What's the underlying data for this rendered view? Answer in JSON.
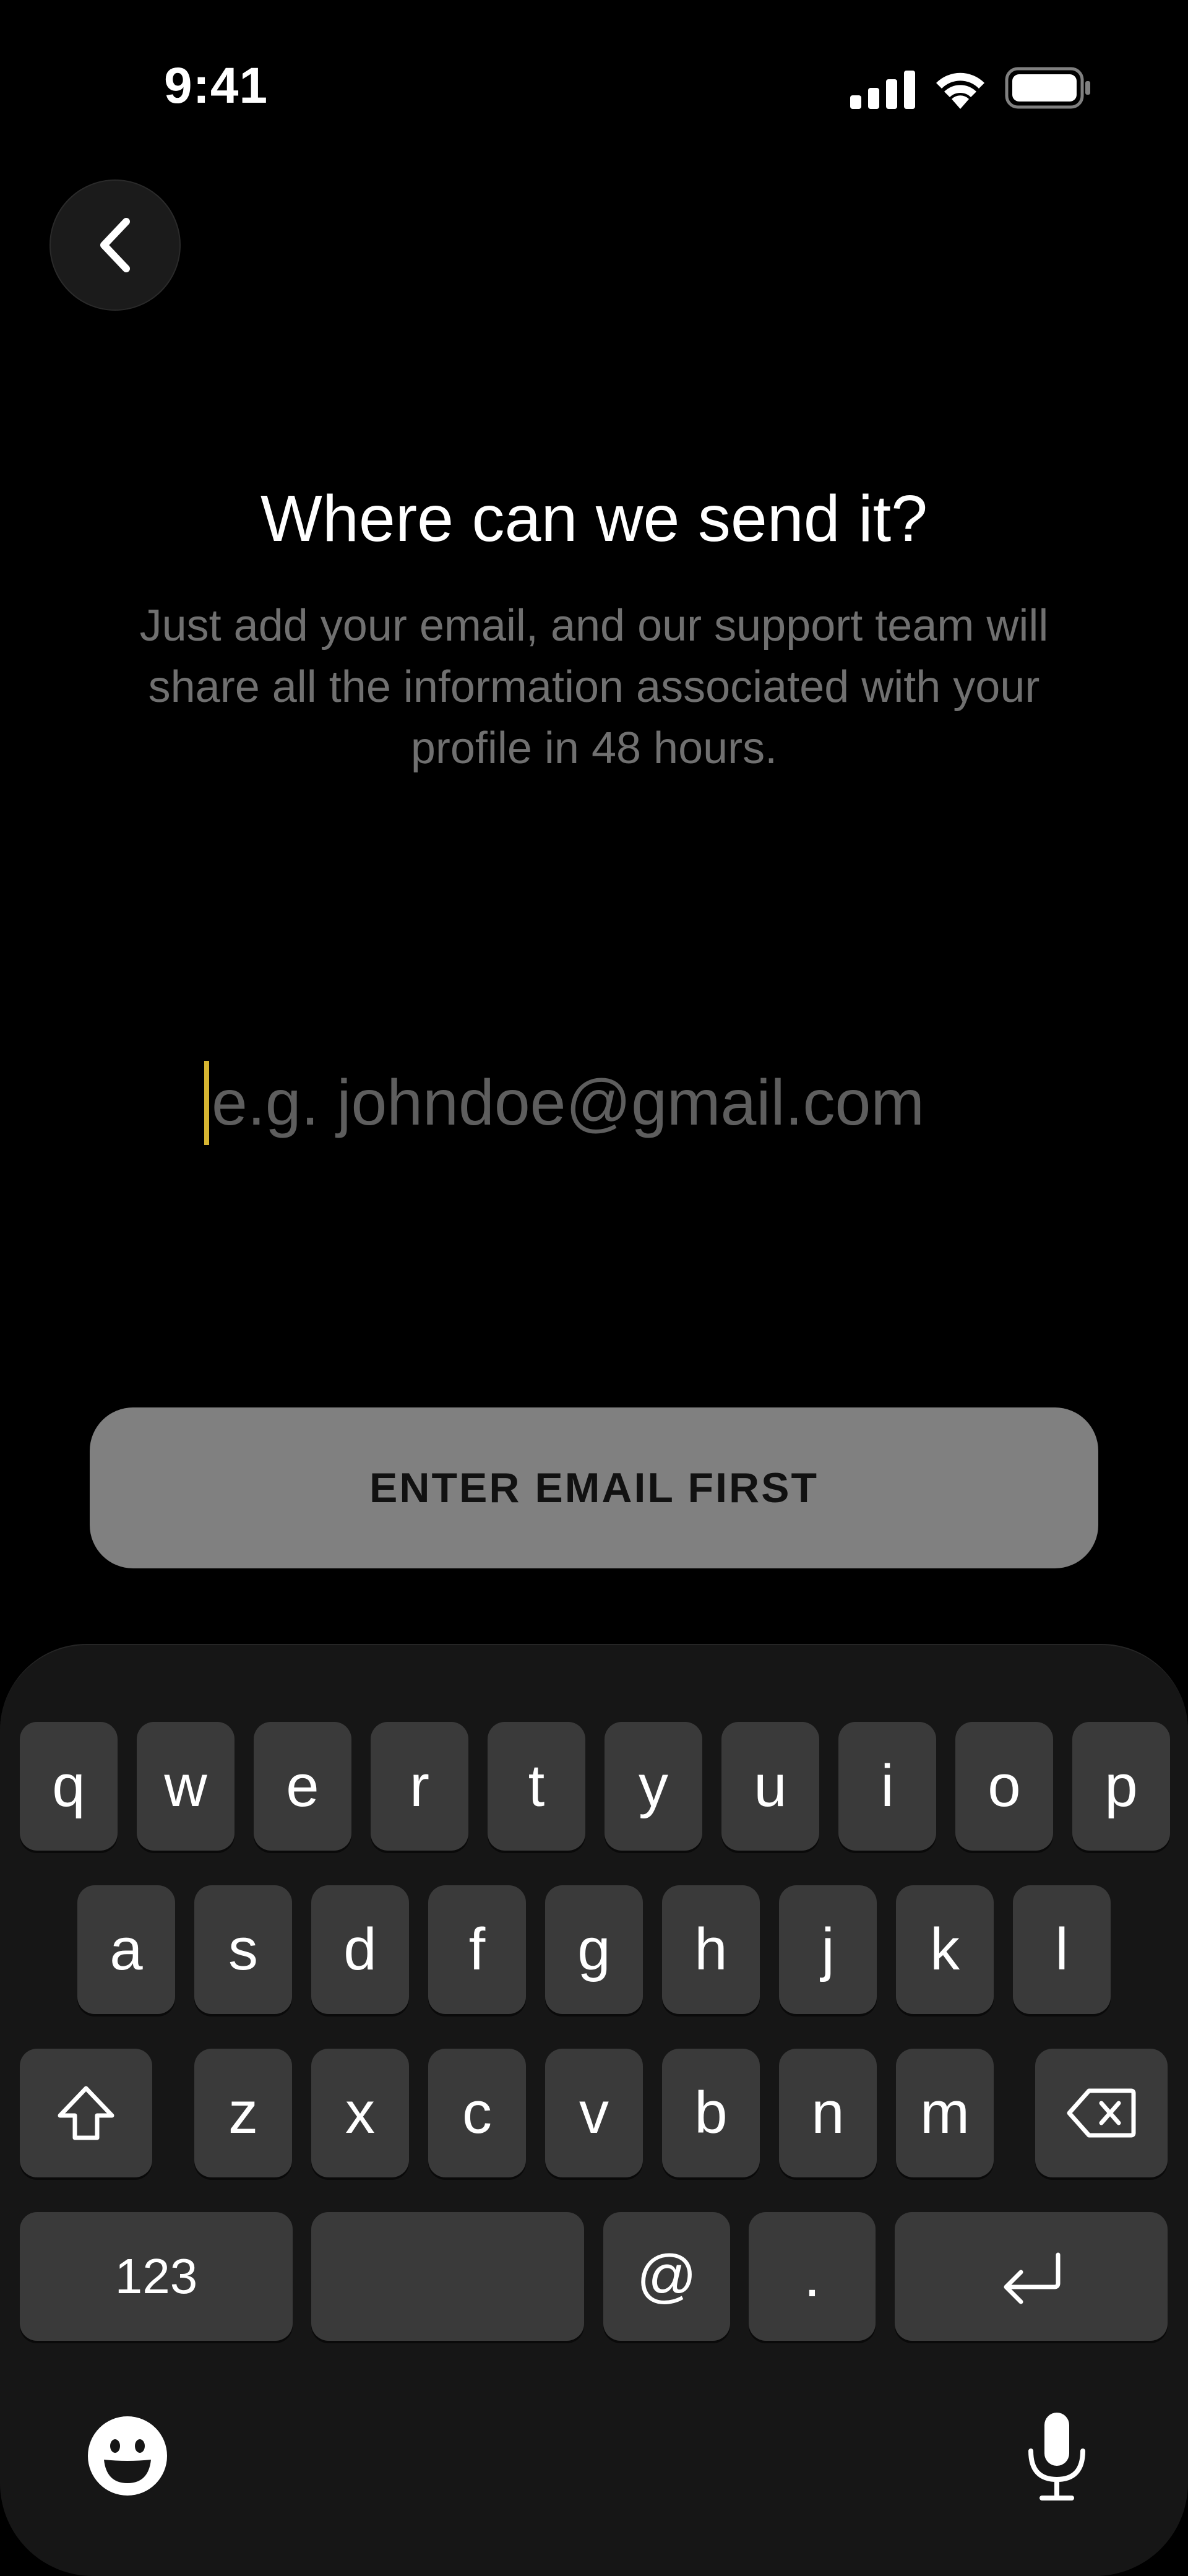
{
  "status_bar": {
    "time": "9:41"
  },
  "header": {
    "back_icon": "chevron-left-icon"
  },
  "content": {
    "title": "Where can we send it?",
    "subtitle": "Just add your email, and our support team will share all the information associated with your profile in 48 hours."
  },
  "email": {
    "value": "",
    "placeholder": "e.g. johndoe@gmail.com"
  },
  "cta": {
    "label": "ENTER EMAIL FIRST"
  },
  "keyboard": {
    "row1": [
      "q",
      "w",
      "e",
      "r",
      "t",
      "y",
      "u",
      "i",
      "o",
      "p"
    ],
    "row2": [
      "a",
      "s",
      "d",
      "f",
      "g",
      "h",
      "j",
      "k",
      "l"
    ],
    "row3": [
      "z",
      "x",
      "c",
      "v",
      "b",
      "n",
      "m"
    ],
    "numbers_label": "123",
    "at_label": "@",
    "dot_label": "."
  },
  "colors": {
    "background": "#000000",
    "caret": "#d6b531",
    "cta_background": "#808080",
    "keyboard_background": "#161616",
    "key_background": "#3a3a3a"
  }
}
